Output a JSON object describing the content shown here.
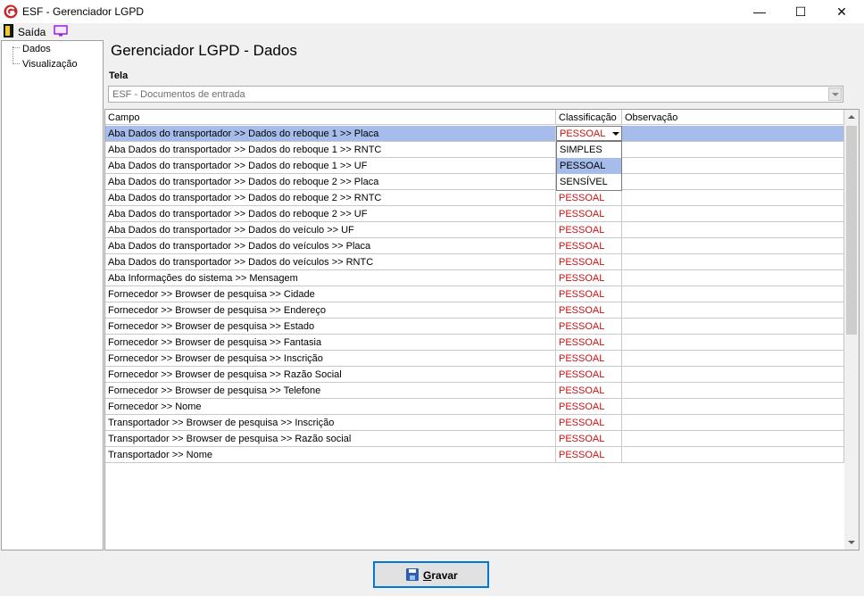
{
  "window": {
    "title": "ESF - Gerenciador LGPD",
    "minimize": "—",
    "maximize": "☐",
    "close": "✕"
  },
  "toolbar": {
    "exit_label": "Saída"
  },
  "tree": {
    "items": [
      "Dados",
      "Visualização"
    ]
  },
  "page": {
    "title": "Gerenciador LGPD - Dados",
    "tela_label": "Tela",
    "tela_value": "ESF - Documentos de entrada"
  },
  "grid": {
    "columns": [
      "Campo",
      "Classificação",
      "Observação"
    ],
    "rows": [
      {
        "campo": "Aba Dados do transportador >> Dados do reboque 1 >> Placa",
        "classificacao": "PESSOAL"
      },
      {
        "campo": "Aba Dados do transportador >> Dados do reboque 1 >> RNTC",
        "classificacao": ""
      },
      {
        "campo": "Aba Dados do transportador >> Dados do reboque 1 >> UF",
        "classificacao": ""
      },
      {
        "campo": "Aba Dados do transportador >> Dados do reboque 2 >> Placa",
        "classificacao": ""
      },
      {
        "campo": "Aba Dados do transportador >> Dados do reboque 2 >> RNTC",
        "classificacao": "PESSOAL"
      },
      {
        "campo": "Aba Dados do transportador >> Dados do reboque 2 >> UF",
        "classificacao": "PESSOAL"
      },
      {
        "campo": "Aba Dados do transportador >> Dados do veículo >> UF",
        "classificacao": "PESSOAL"
      },
      {
        "campo": "Aba Dados do transportador >> Dados do veículos >> Placa",
        "classificacao": "PESSOAL"
      },
      {
        "campo": "Aba Dados do transportador >> Dados do veículos >> RNTC",
        "classificacao": "PESSOAL"
      },
      {
        "campo": "Aba Informações do sistema >> Mensagem",
        "classificacao": "PESSOAL"
      },
      {
        "campo": "Fornecedor >> Browser de pesquisa >> Cidade",
        "classificacao": "PESSOAL"
      },
      {
        "campo": "Fornecedor >> Browser de pesquisa >> Endereço",
        "classificacao": "PESSOAL"
      },
      {
        "campo": "Fornecedor >> Browser de pesquisa >> Estado",
        "classificacao": "PESSOAL"
      },
      {
        "campo": "Fornecedor >> Browser de pesquisa >> Fantasia",
        "classificacao": "PESSOAL"
      },
      {
        "campo": "Fornecedor >> Browser de pesquisa >> Inscrição",
        "classificacao": "PESSOAL"
      },
      {
        "campo": "Fornecedor >> Browser de pesquisa >> Razão Social",
        "classificacao": "PESSOAL"
      },
      {
        "campo": "Fornecedor >> Browser de pesquisa >> Telefone",
        "classificacao": "PESSOAL"
      },
      {
        "campo": "Fornecedor >> Nome",
        "classificacao": "PESSOAL"
      },
      {
        "campo": "Transportador >> Browser de pesquisa >> Inscrição",
        "classificacao": "PESSOAL"
      },
      {
        "campo": "Transportador >> Browser de pesquisa >> Razão social",
        "classificacao": "PESSOAL"
      },
      {
        "campo": "Transportador >> Nome",
        "classificacao": "PESSOAL"
      }
    ],
    "dropdown_options": [
      "SIMPLES",
      "PESSOAL",
      "SENSÍVEL"
    ],
    "dropdown_highlighted": "PESSOAL"
  },
  "buttons": {
    "save_label": "Gravar"
  },
  "colors": {
    "selection": "#a6bcea",
    "classification_text": "#cc1111",
    "save_icon": "#2a5fb4"
  }
}
